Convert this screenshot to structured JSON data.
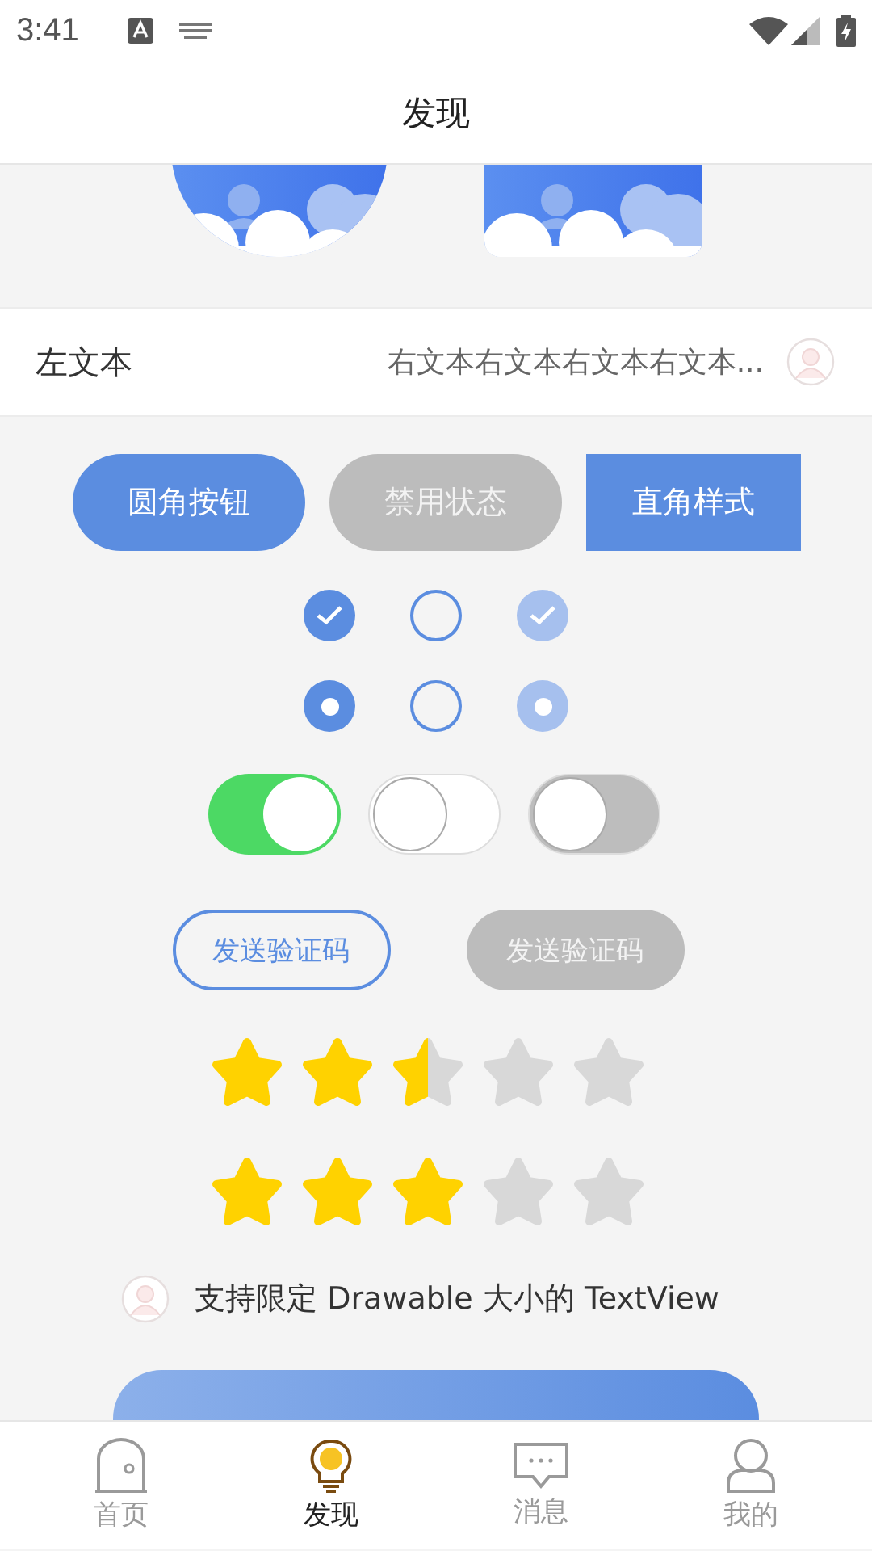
{
  "status_bar": {
    "time": "3:41"
  },
  "title": "发现",
  "info_row": {
    "left": "左文本",
    "right": "右文本右文本右文本右文本..."
  },
  "buttons": [
    {
      "label": "圆角按钮",
      "kind": "round",
      "disabled": false
    },
    {
      "label": "禁用状态",
      "kind": "round",
      "disabled": true
    },
    {
      "label": "直角样式",
      "kind": "square",
      "disabled": false
    }
  ],
  "checkboxes": [
    {
      "checked": true,
      "disabled": false
    },
    {
      "checked": false,
      "disabled": false
    },
    {
      "checked": true,
      "disabled": true
    }
  ],
  "radios": [
    {
      "selected": true,
      "disabled": false
    },
    {
      "selected": false,
      "disabled": false
    },
    {
      "selected": true,
      "disabled": true
    }
  ],
  "switches": [
    {
      "on": true,
      "disabled": false
    },
    {
      "on": false,
      "disabled": false
    },
    {
      "on": false,
      "disabled": true
    }
  ],
  "code_buttons": [
    {
      "label": "发送验证码",
      "disabled": false
    },
    {
      "label": "发送验证码",
      "disabled": true
    }
  ],
  "ratings": [
    {
      "stars": 2.5
    },
    {
      "stars": 3
    }
  ],
  "drawable_text": "支持限定 Drawable 大小的 TextView",
  "tabs": [
    {
      "label": "首页",
      "kind": "home",
      "selected": false
    },
    {
      "label": "发现",
      "kind": "bulb",
      "selected": true
    },
    {
      "label": "消息",
      "kind": "chat",
      "selected": false
    },
    {
      "label": "我的",
      "kind": "person",
      "selected": false
    }
  ]
}
